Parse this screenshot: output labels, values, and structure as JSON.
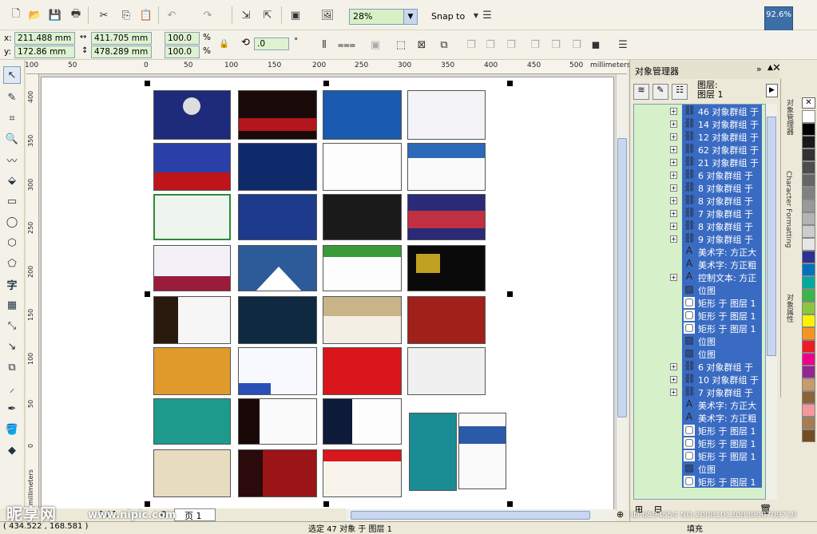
{
  "toolbar": {
    "zoom_value": "28%",
    "snap_label": "Snap to",
    "zoom_badge": "92.6%"
  },
  "property_bar": {
    "x_label": "x:",
    "x_value": "211.488 mm",
    "y_label": "y:",
    "y_value": "172.86 mm",
    "width_value": "411.705 mm",
    "height_value": "478.289 mm",
    "scale_x": "100.0",
    "scale_y": "100.0",
    "percent": "%",
    "rotation": ".0",
    "degree": "°"
  },
  "ruler": {
    "unit": "millimeters",
    "top_ticks": [
      "100",
      "50",
      "0",
      "50",
      "100",
      "150",
      "200",
      "250",
      "300",
      "350",
      "400",
      "450",
      "500"
    ],
    "left_ticks": [
      "400",
      "350",
      "300",
      "250",
      "200",
      "150",
      "100",
      "50",
      "0"
    ],
    "left_unit": "millimeters"
  },
  "page_tab": {
    "label": "页 1",
    "counter": "1 / 1"
  },
  "status": {
    "coords": "( 434.522 , 168.581 )",
    "selection": "选定 47 对象 于 图层 1",
    "right_text": "填充"
  },
  "docker": {
    "title": "对象管理器",
    "layer_line1": "图层:",
    "layer_line2": "图层 1",
    "rows": [
      {
        "text": "46 对象群组 于",
        "icon": "group-icon",
        "expand": true
      },
      {
        "text": "14 对象群组 于",
        "icon": "group-icon",
        "expand": true
      },
      {
        "text": "12 对象群组 于",
        "icon": "group-icon",
        "expand": true
      },
      {
        "text": "62 对象群组 于",
        "icon": "group-icon",
        "expand": true
      },
      {
        "text": "21 对象群组 于",
        "icon": "group-icon",
        "expand": true
      },
      {
        "text": "6 对象群组 于",
        "icon": "group-icon",
        "expand": true
      },
      {
        "text": "8 对象群组 于",
        "icon": "group-icon",
        "expand": true
      },
      {
        "text": "8 对象群组 于",
        "icon": "group-icon",
        "expand": true
      },
      {
        "text": "7 对象群组 于",
        "icon": "group-icon",
        "expand": true
      },
      {
        "text": "8 对象群组 于",
        "icon": "group-icon",
        "expand": true
      },
      {
        "text": "9 对象群组 于",
        "icon": "group-icon",
        "expand": true
      },
      {
        "text": "美术字: 方正大",
        "icon": "text-icon",
        "expand": false
      },
      {
        "text": "美术字: 方正粗",
        "icon": "text-icon",
        "expand": false
      },
      {
        "text": "控制文本: 方正",
        "icon": "text-icon",
        "expand": true
      },
      {
        "text": "位图",
        "icon": "bitmap-icon",
        "expand": false
      },
      {
        "text": "矩形 于 图层 1",
        "icon": "rect-icon",
        "expand": false
      },
      {
        "text": "矩形 于 图层 1",
        "icon": "rect-icon",
        "expand": false
      },
      {
        "text": "矩形 于 图层 1",
        "icon": "rect-icon",
        "expand": false
      },
      {
        "text": "位图",
        "icon": "bitmap-icon",
        "expand": false
      },
      {
        "text": "位图",
        "icon": "bitmap-icon",
        "expand": false
      },
      {
        "text": "6 对象群组 于",
        "icon": "group-icon",
        "expand": true
      },
      {
        "text": "10 对象群组 于",
        "icon": "group-icon",
        "expand": true
      },
      {
        "text": "7 对象群组 于",
        "icon": "group-icon",
        "expand": true
      },
      {
        "text": "美术字: 方正大",
        "icon": "text-icon",
        "expand": false
      },
      {
        "text": "美术字: 方正粗",
        "icon": "text-icon",
        "expand": false
      },
      {
        "text": "矩形 于 图层 1",
        "icon": "rect-icon",
        "expand": false
      },
      {
        "text": "矩形 于 图层 1",
        "icon": "rect-icon",
        "expand": false
      },
      {
        "text": "矩形 于 图层 1",
        "icon": "rect-icon",
        "expand": false
      },
      {
        "text": "位图",
        "icon": "bitmap-icon",
        "expand": false
      },
      {
        "text": "矩形 于 图层 1",
        "icon": "rect-icon",
        "expand": false
      }
    ]
  },
  "side_tabs": [
    "对象管理器",
    "Character Formatting",
    "对象属性"
  ],
  "palette_colors": [
    "#ffffff",
    "#000000",
    "#1a1a1a",
    "#333333",
    "#4d4d4d",
    "#666666",
    "#808080",
    "#999999",
    "#b3b3b3",
    "#cccccc",
    "#e6e6e6",
    "#2e3192",
    "#0071bc",
    "#00a99d",
    "#39b54a",
    "#8cc63f",
    "#fff200",
    "#f7941d",
    "#ed1c24",
    "#ec008c",
    "#92278f",
    "#c69c6d",
    "#8c6239",
    "#f5989d",
    "#a67c52",
    "#754c24"
  ],
  "watermark": {
    "logo": "昵享网",
    "site": "www.nipic.com",
    "id": "ID:6594554 NO:20081013083900709719"
  }
}
